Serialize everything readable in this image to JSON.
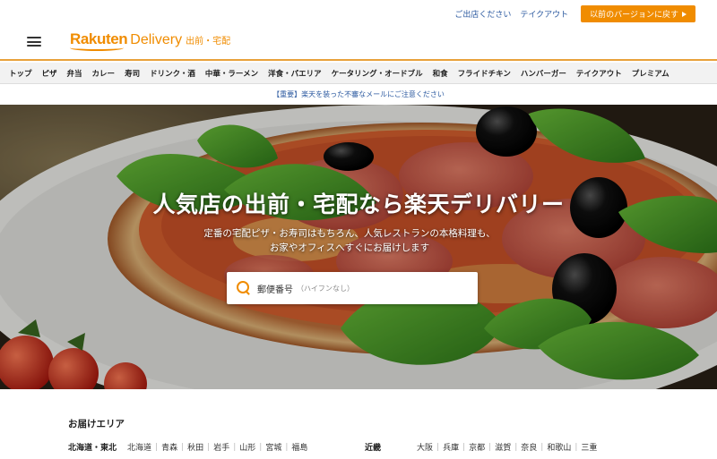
{
  "header": {
    "links": [
      "ご出店ください",
      "テイクアウト"
    ],
    "legacy_button": "以前のバージョンに戻す",
    "logo_main": "Rakuten",
    "logo_delivery": "Delivery",
    "logo_sub": "出前・宅配"
  },
  "categories": [
    "トップ",
    "ピザ",
    "弁当",
    "カレー",
    "寿司",
    "ドリンク・酒",
    "中華・ラーメン",
    "洋食・パエリア",
    "ケータリング・オードブル",
    "和食",
    "フライドチキン",
    "ハンバーガー",
    "テイクアウト",
    "プレミアム"
  ],
  "notice": "【重要】楽天を装った不審なメールにご注意ください",
  "hero": {
    "title": "人気店の出前・宅配なら楽天デリバリー",
    "subtitle_line1": "定番の宅配ピザ・お寿司はもちろん、人気レストランの本格料理も、",
    "subtitle_line2": "お家やオフィスへすぐにお届けします"
  },
  "search": {
    "label": "郵便番号",
    "hint": "（ハイフンなし）"
  },
  "area": {
    "title": "お届けエリア",
    "regions": [
      {
        "name": "北海道・東北",
        "prefectures": [
          "北海道",
          "青森",
          "秋田",
          "岩手",
          "山形",
          "宮城",
          "福島"
        ]
      },
      {
        "name": "近畿",
        "prefectures": [
          "大阪",
          "兵庫",
          "京都",
          "滋賀",
          "奈良",
          "和歌山",
          "三重"
        ]
      }
    ]
  },
  "colors": {
    "accent": "#f08c00",
    "link": "#2c5aa0"
  }
}
